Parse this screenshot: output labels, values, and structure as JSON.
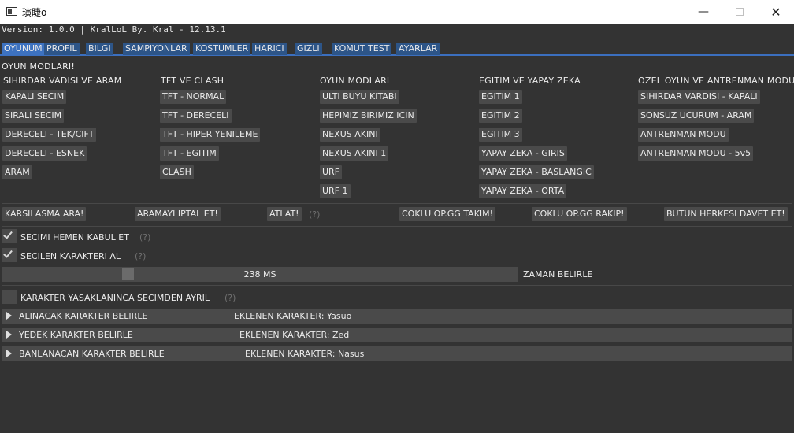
{
  "window": {
    "title": "璌睫o",
    "minimize_glyph": "—",
    "close_glyph": "✕"
  },
  "version": "Version: 1.0.0 | KralLoL By. Kral - 12.13.1",
  "tabs": [
    "OYUNUM",
    "PROFIL",
    "BILGI",
    "SAMPIYONLAR",
    "KOSTUMLER",
    "HARICI",
    "GIZLI",
    "KOMUT TEST",
    "AYARLAR"
  ],
  "section_title": "OYUN MODLARI!",
  "columns": [
    {
      "heading": "SIHIRDAR VADISI VE ARAM",
      "buttons": [
        "KAPALI SECIM",
        "SIRALI SECIM",
        "DERECELI - TEK/CIFT",
        "DERECELI - ESNEK",
        "ARAM"
      ]
    },
    {
      "heading": "TFT VE CLASH",
      "buttons": [
        "TFT - NORMAL",
        "TFT - DERECELI",
        "TFT - HIPER YENILEME",
        "TFT - EGITIM",
        "CLASH"
      ]
    },
    {
      "heading": "OYUN MODLARI",
      "buttons": [
        "ULTI BUYU KITABI",
        "HEPIMIZ BIRIMIZ ICIN",
        "NEXUS AKINI",
        "NEXUS AKINI 1",
        "URF",
        "URF 1"
      ]
    },
    {
      "heading": "EGITIM VE YAPAY ZEKA",
      "buttons": [
        "EGITIM 1",
        "EGITIM 2",
        "EGITIM 3",
        "YAPAY ZEKA - GIRIS",
        "YAPAY ZEKA - BASLANGIC",
        "YAPAY ZEKA - ORTA"
      ]
    },
    {
      "heading": "OZEL OYUN VE ANTRENMAN MODU",
      "buttons": [
        "SIHIRDAR VARDISI - KAPALI",
        "SONSUZ UCURUM - ARAM",
        "ANTRENMAN MODU",
        "ANTRENMAN MODU - 5v5"
      ]
    }
  ],
  "actions": {
    "search": "KARSILASMA ARA!",
    "cancel": "ARAMAYI IPTAL ET!",
    "skip": "ATLAT!",
    "skip_hint": "(?)",
    "opgg_team": "COKLU OP.GG TAKIM!",
    "opgg_enemy": "COKLU OP.GG RAKIP!",
    "invite_all": "BUTUN HERKESI DAVET ET!"
  },
  "options": [
    {
      "label": "SECIMI HEMEN KABUL ET",
      "hint": "(?)",
      "checked": true
    },
    {
      "label": "SECILEN KARAKTERI AL",
      "hint": "(?)",
      "checked": true
    }
  ],
  "slider": {
    "value_text": "238 MS",
    "label": "ZAMAN BELIRLE",
    "fraction": 0.238
  },
  "ban_option": {
    "label": "KARAKTER YASAKLANINCA SECIMDEN AYRIL",
    "hint": "(?)",
    "checked": false
  },
  "collapsibles": [
    {
      "label": "ALINACAK KARAKTER BELIRLE",
      "added": "EKLENEN KARAKTER: Yasuo"
    },
    {
      "label": "YEDEK KARAKTER BELIRLE",
      "added": "EKLENEN KARAKTER: Zed"
    },
    {
      "label": "BANLANACAN KARAKTER BELIRLE",
      "added": "EKLENEN KARAKTER: Nasus"
    }
  ],
  "colors": {
    "background": "#333333",
    "widget": "#4a4a4a",
    "tab": "#2d5588",
    "tab_active": "#3d72c0",
    "accent_line": "#3b6fbf"
  }
}
